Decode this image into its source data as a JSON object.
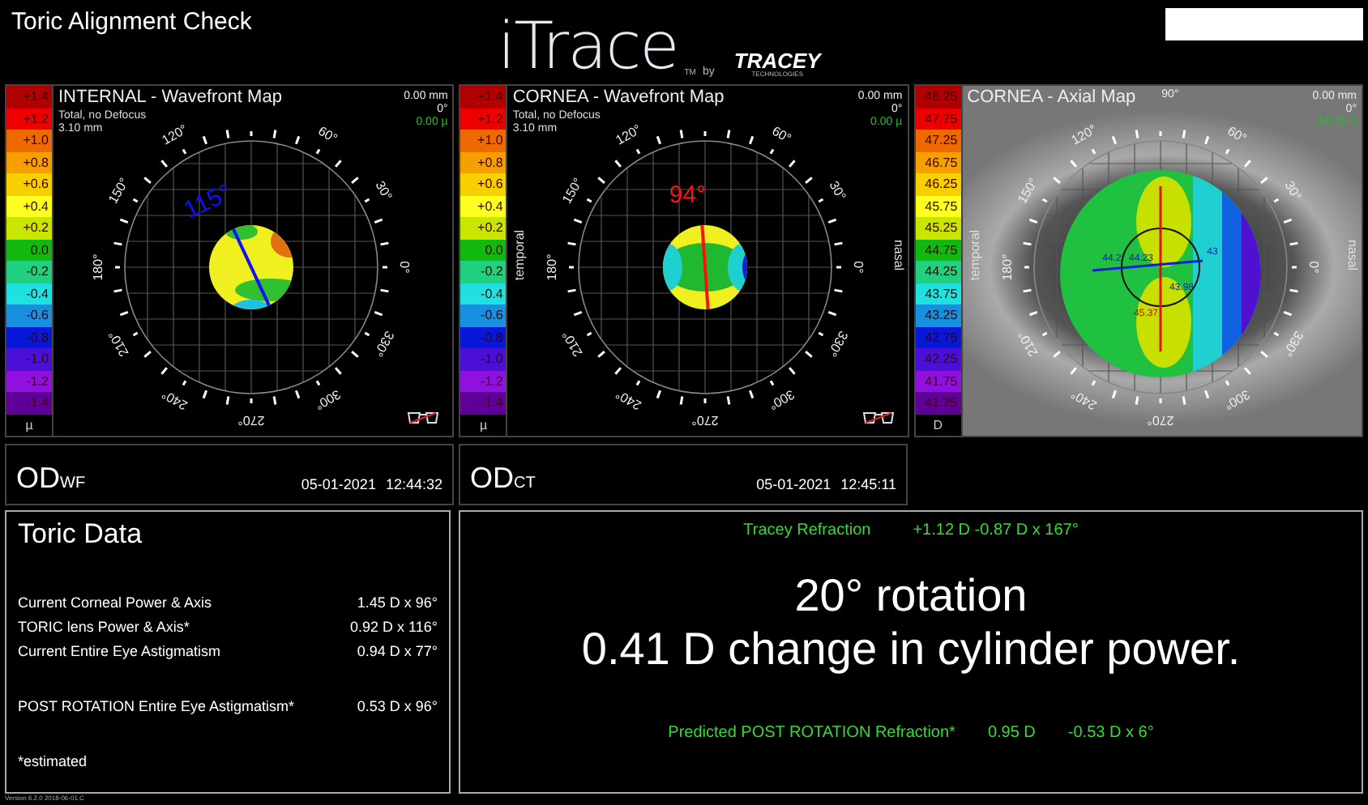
{
  "window": {
    "title": "Toric Alignment Check"
  },
  "logo": {
    "name": "iTrace",
    "tm": "TM",
    "by": "by",
    "company": "TRACEY",
    "company_sub": "TECHNOLOGIES"
  },
  "maps": [
    {
      "kind": "wavefront_internal",
      "title": "INTERNAL - Wavefront Map",
      "subtitle": [
        "Total, no Defocus",
        "3.10 mm"
      ],
      "readings": [
        "0.00 mm",
        "0°",
        "0.00 µ"
      ],
      "axis_label": "115°",
      "degree_labels": [
        "0°",
        "30°",
        "60°",
        "120°",
        "150°",
        "180°",
        "210°",
        "240°",
        "270°",
        "300°",
        "330°"
      ],
      "glasses": true,
      "scale": {
        "unit": "µ",
        "steps": [
          {
            "label": "+1.4",
            "color": "#b00000"
          },
          {
            "label": "+1.2",
            "color": "#ee0000"
          },
          {
            "label": "+1.0",
            "color": "#ee6a00"
          },
          {
            "label": "+0.8",
            "color": "#f5a000"
          },
          {
            "label": "+0.6",
            "color": "#f8d000"
          },
          {
            "label": "+0.4",
            "color": "#ffff20"
          },
          {
            "label": "+0.2",
            "color": "#c8e600"
          },
          {
            "label": "0.0",
            "color": "#10b810"
          },
          {
            "label": "-0.2",
            "color": "#20d080"
          },
          {
            "label": "-0.4",
            "color": "#20e0e0"
          },
          {
            "label": "-0.6",
            "color": "#1890e0"
          },
          {
            "label": "-0.8",
            "color": "#0818d8"
          },
          {
            "label": "-1.0",
            "color": "#4a10d8"
          },
          {
            "label": "-1.2",
            "color": "#9010e0"
          },
          {
            "label": "-1.4",
            "color": "#600098"
          }
        ]
      }
    },
    {
      "kind": "wavefront_cornea",
      "title": "CORNEA - Wavefront Map",
      "subtitle": [
        "Total, no Defocus",
        "3.10 mm"
      ],
      "readings": [
        "0.00 mm",
        "0°",
        "0.00 µ"
      ],
      "axis_label": "94°",
      "side_labels": [
        "temporal",
        "nasal"
      ],
      "degree_labels": [
        "0°",
        "30°",
        "60°",
        "120°",
        "150°",
        "180°",
        "210°",
        "240°",
        "270°",
        "300°",
        "330°"
      ],
      "glasses": true,
      "scale": {
        "unit": "µ",
        "steps": [
          {
            "label": "+1.4",
            "color": "#b00000"
          },
          {
            "label": "+1.2",
            "color": "#ee0000"
          },
          {
            "label": "+1.0",
            "color": "#ee6a00"
          },
          {
            "label": "+0.8",
            "color": "#f5a000"
          },
          {
            "label": "+0.6",
            "color": "#f8d000"
          },
          {
            "label": "+0.4",
            "color": "#ffff20"
          },
          {
            "label": "+0.2",
            "color": "#c8e600"
          },
          {
            "label": "0.0",
            "color": "#10b810"
          },
          {
            "label": "-0.2",
            "color": "#20d080"
          },
          {
            "label": "-0.4",
            "color": "#20e0e0"
          },
          {
            "label": "-0.6",
            "color": "#1890e0"
          },
          {
            "label": "-0.8",
            "color": "#0818d8"
          },
          {
            "label": "-1.0",
            "color": "#4a10d8"
          },
          {
            "label": "-1.2",
            "color": "#9010e0"
          },
          {
            "label": "-1.4",
            "color": "#600098"
          }
        ]
      }
    },
    {
      "kind": "axial",
      "title": "CORNEA - Axial Map",
      "top_label": "90°",
      "readings": [
        "0.00 mm",
        "0°",
        "44.75 D"
      ],
      "side_labels": [
        "temporal",
        "nasal"
      ],
      "degree_labels": [
        "0°",
        "30°",
        "60°",
        "120°",
        "150°",
        "180°",
        "210°",
        "240°",
        "270°",
        "300°",
        "330°"
      ],
      "glasses": false,
      "map_values": [
        "44.2",
        "44.23",
        "43.98",
        "43",
        "45.37"
      ],
      "scale": {
        "unit": "D",
        "steps": [
          {
            "label": "48.25",
            "color": "#b00000"
          },
          {
            "label": "47.75",
            "color": "#ee0000"
          },
          {
            "label": "47.25",
            "color": "#ee6a00"
          },
          {
            "label": "46.75",
            "color": "#f5a000"
          },
          {
            "label": "46.25",
            "color": "#f8d000"
          },
          {
            "label": "45.75",
            "color": "#ffff20"
          },
          {
            "label": "45.25",
            "color": "#c8e600"
          },
          {
            "label": "44.75",
            "color": "#10b810"
          },
          {
            "label": "44.25",
            "color": "#20d080"
          },
          {
            "label": "43.75",
            "color": "#20e0e0"
          },
          {
            "label": "43.25",
            "color": "#1890e0"
          },
          {
            "label": "42.75",
            "color": "#0818d8"
          },
          {
            "label": "42.25",
            "color": "#4a10d8"
          },
          {
            "label": "41.75",
            "color": "#9010e0"
          },
          {
            "label": "41.25",
            "color": "#600098"
          }
        ]
      }
    }
  ],
  "exams": [
    {
      "eye": "OD$_{WF}$",
      "date": "05-01-2021",
      "time": "12:44:32"
    },
    {
      "eye": "OD$_{CT}$",
      "date": "05-01-2021",
      "time": "12:45:11"
    }
  ],
  "toric_data": {
    "title": "Toric Data",
    "rows": [
      {
        "label": "Current Corneal Power & Axis",
        "value": "1.45 D x 96°"
      },
      {
        "label": "TORIC lens Power & Axis*",
        "value": "0.92 D x 116°"
      },
      {
        "label": "Current Entire Eye Astigmatism",
        "value": "0.94 D x 77°"
      }
    ],
    "post_rows": [
      {
        "label": "POST ROTATION Entire Eye Astigmatism*",
        "value": "0.53 D x 96°"
      }
    ],
    "footnote": "*estimated"
  },
  "result": {
    "refraction_label": "Tracey Refraction",
    "refraction_value": "+1.12 D -0.87 D x 167°",
    "headline": [
      "20° rotation",
      "0.41 D change in cylinder power."
    ],
    "predicted_label": "Predicted POST ROTATION Refraction*",
    "predicted_values": [
      "0.95 D",
      "-0.53 D x 6°"
    ]
  },
  "version": "Version 6.2.0 2018-06-01.C"
}
